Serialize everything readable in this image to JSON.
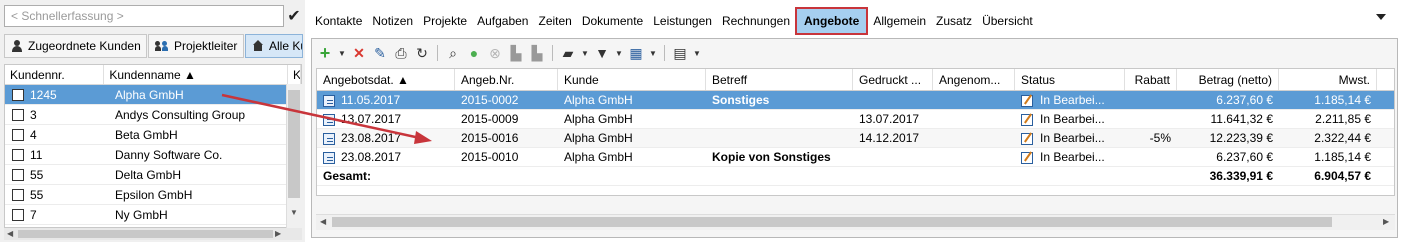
{
  "left": {
    "quick_placeholder": "< Schnellerfassung >",
    "tabs": [
      {
        "label": "Zugeordnete Kunden",
        "icon": "person-icon"
      },
      {
        "label": "Projektleiter",
        "icon": "people-icon"
      },
      {
        "label": "Alle Ku",
        "icon": "house-icon"
      }
    ],
    "columns": [
      "Kundennr.",
      "Kundenname ▲",
      "K"
    ],
    "rows": [
      {
        "nr": "1245",
        "name": "Alpha GmbH"
      },
      {
        "nr": "3",
        "name": "Andys Consulting Group"
      },
      {
        "nr": "4",
        "name": "Beta GmbH"
      },
      {
        "nr": "11",
        "name": "Danny Software Co."
      },
      {
        "nr": "55",
        "name": "Delta GmbH"
      },
      {
        "nr": "55",
        "name": "Epsilon GmbH"
      },
      {
        "nr": "7",
        "name": "Ny GmbH"
      }
    ]
  },
  "nav": [
    "Kontakte",
    "Notizen",
    "Projekte",
    "Aufgaben",
    "Zeiten",
    "Dokumente",
    "Leistungen",
    "Rechnungen",
    "Angebote",
    "Allgemein",
    "Zusatz",
    "Übersicht"
  ],
  "grid": {
    "columns": [
      "Angebotsdat. ▲",
      "Angeb.Nr.",
      "Kunde",
      "Betreff",
      "Gedruckt ...",
      "Angenom...",
      "Status",
      "Rabatt",
      "Betrag (netto)",
      "Mwst."
    ],
    "rows": [
      {
        "date": "11.05.2017",
        "nr": "2015-0002",
        "kunde": "Alpha GmbH",
        "betreff": "Sonstiges",
        "gedruckt": "",
        "angenommen": "",
        "status": "In Bearbei...",
        "rabatt": "",
        "betrag": "6.237,60 €",
        "mwst": "1.185,14 €"
      },
      {
        "date": "13.07.2017",
        "nr": "2015-0009",
        "kunde": "Alpha GmbH",
        "betreff": "",
        "gedruckt": "13.07.2017",
        "angenommen": "",
        "status": "In Bearbei...",
        "rabatt": "",
        "betrag": "11.641,32 €",
        "mwst": "2.211,85 €"
      },
      {
        "date": "23.08.2017",
        "nr": "2015-0016",
        "kunde": "Alpha GmbH",
        "betreff": "",
        "gedruckt": "14.12.2017",
        "angenommen": "",
        "status": "In Bearbei...",
        "rabatt": "-5%",
        "betrag": "12.223,39 €",
        "mwst": "2.322,44 €"
      },
      {
        "date": "23.08.2017",
        "nr": "2015-0010",
        "kunde": "Alpha GmbH",
        "betreff": "Kopie von Sonstiges",
        "gedruckt": "",
        "angenommen": "",
        "status": "In Bearbei...",
        "rabatt": "",
        "betrag": "6.237,60 €",
        "mwst": "1.185,14 €"
      }
    ],
    "total_label": "Gesamt:",
    "total_betrag": "36.339,91 €",
    "total_mwst": "6.904,57 €"
  },
  "colors": {
    "selected": "#5b9bd5",
    "highlight_border": "#c8353b",
    "arrow": "#c8353b"
  }
}
